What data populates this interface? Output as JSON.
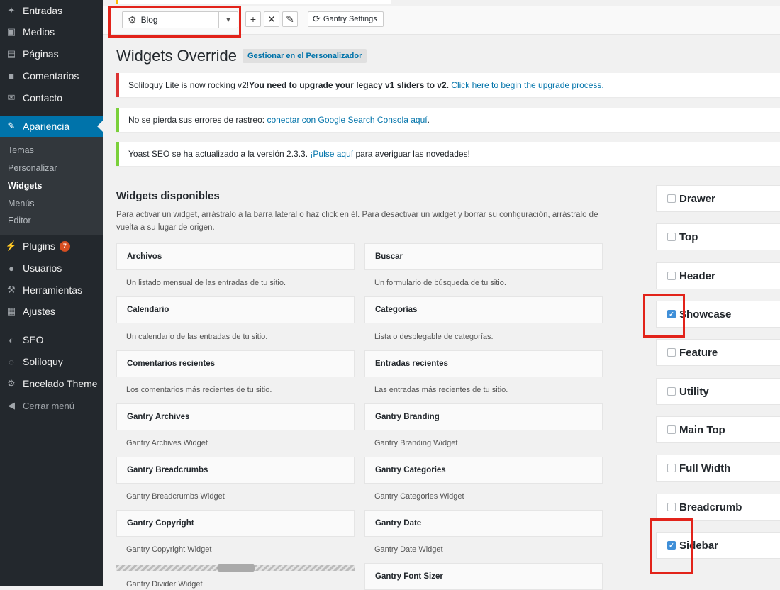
{
  "sidebar": {
    "items": [
      {
        "label": "Entradas",
        "icon": "pin-icon"
      },
      {
        "label": "Medios",
        "icon": "media-icon"
      },
      {
        "label": "Páginas",
        "icon": "pages-icon"
      },
      {
        "label": "Comentarios",
        "icon": "comment-icon"
      },
      {
        "label": "Contacto",
        "icon": "mail-icon"
      },
      {
        "label": "Apariencia",
        "icon": "brush-icon"
      },
      {
        "label": "Plugins",
        "icon": "plugin-icon",
        "badge": "7"
      },
      {
        "label": "Usuarios",
        "icon": "user-icon"
      },
      {
        "label": "Herramientas",
        "icon": "wrench-icon"
      },
      {
        "label": "Ajustes",
        "icon": "settings-icon"
      },
      {
        "label": "SEO",
        "icon": "seo-icon"
      },
      {
        "label": "Soliloquy",
        "icon": "soliloquy-icon"
      },
      {
        "label": "Encelado Theme",
        "icon": "gear-icon"
      },
      {
        "label": "Cerrar menú",
        "icon": "collapse-icon"
      }
    ],
    "submenu": [
      "Temas",
      "Personalizar",
      "Widgets",
      "Menús",
      "Editor"
    ]
  },
  "toolbar": {
    "select_value": "Blog",
    "add_label": "+",
    "delete_label": "✕",
    "edit_label": "✎",
    "gantry_settings_label": "Gantry Settings"
  },
  "page": {
    "title": "Widgets Override",
    "manage_link": "Gestionar en el Personalizador"
  },
  "notices": {
    "soliloquy": {
      "prefix": "Soliloquy Lite is now rocking v2! ",
      "bold": "You need to upgrade your legacy v1 sliders to v2.",
      "link": "Click here to begin the upgrade process."
    },
    "search_console": {
      "prefix": "No se pierda sus errores de rastreo: ",
      "link": "conectar con Google Search Consola aquí",
      "suffix": "."
    },
    "yoast": {
      "prefix": "Yoast SEO se ha actualizado a la versión 2.3.3. ",
      "link": "¡Pulse aquí",
      "suffix": " para averiguar las novedades!"
    }
  },
  "available": {
    "title": "Widgets disponibles",
    "description": "Para activar un widget, arrástralo a la barra lateral o haz click en él. Para desactivar un widget y borrar su configuración, arrástralo de vuelta a su lugar de origen.",
    "widgets": [
      {
        "title": "Archivos",
        "desc": "Un listado mensual de las entradas de tu sitio."
      },
      {
        "title": "Buscar",
        "desc": "Un formulario de búsqueda de tu sitio."
      },
      {
        "title": "Calendario",
        "desc": "Un calendario de las entradas de tu sitio."
      },
      {
        "title": "Categorías",
        "desc": "Lista o desplegable de categorías."
      },
      {
        "title": "Comentarios recientes",
        "desc": "Los comentarios más recientes de tu sitio."
      },
      {
        "title": "Entradas recientes",
        "desc": "Las entradas más recientes de tu sitio."
      },
      {
        "title": "Gantry Archives",
        "desc": "Gantry Archives Widget"
      },
      {
        "title": "Gantry Branding",
        "desc": "Gantry Branding Widget"
      },
      {
        "title": "Gantry Breadcrumbs",
        "desc": "Gantry Breadcrumbs Widget"
      },
      {
        "title": "Gantry Categories",
        "desc": "Gantry Categories Widget"
      },
      {
        "title": "Gantry Copyright",
        "desc": "Gantry Copyright Widget"
      },
      {
        "title": "Gantry Date",
        "desc": "Gantry Date Widget"
      }
    ],
    "font_sizer": "Gantry Font Sizer",
    "divider_desc": "Gantry Divider Widget"
  },
  "areas": [
    {
      "label": "Drawer",
      "checked": false
    },
    {
      "label": "Top",
      "checked": false
    },
    {
      "label": "Header",
      "checked": false
    },
    {
      "label": "Showcase",
      "checked": true
    },
    {
      "label": "Feature",
      "checked": false
    },
    {
      "label": "Utility",
      "checked": false
    },
    {
      "label": "Main Top",
      "checked": false
    },
    {
      "label": "Full Width",
      "checked": false
    },
    {
      "label": "Breadcrumb",
      "checked": false
    },
    {
      "label": "Sidebar",
      "checked": true
    }
  ]
}
